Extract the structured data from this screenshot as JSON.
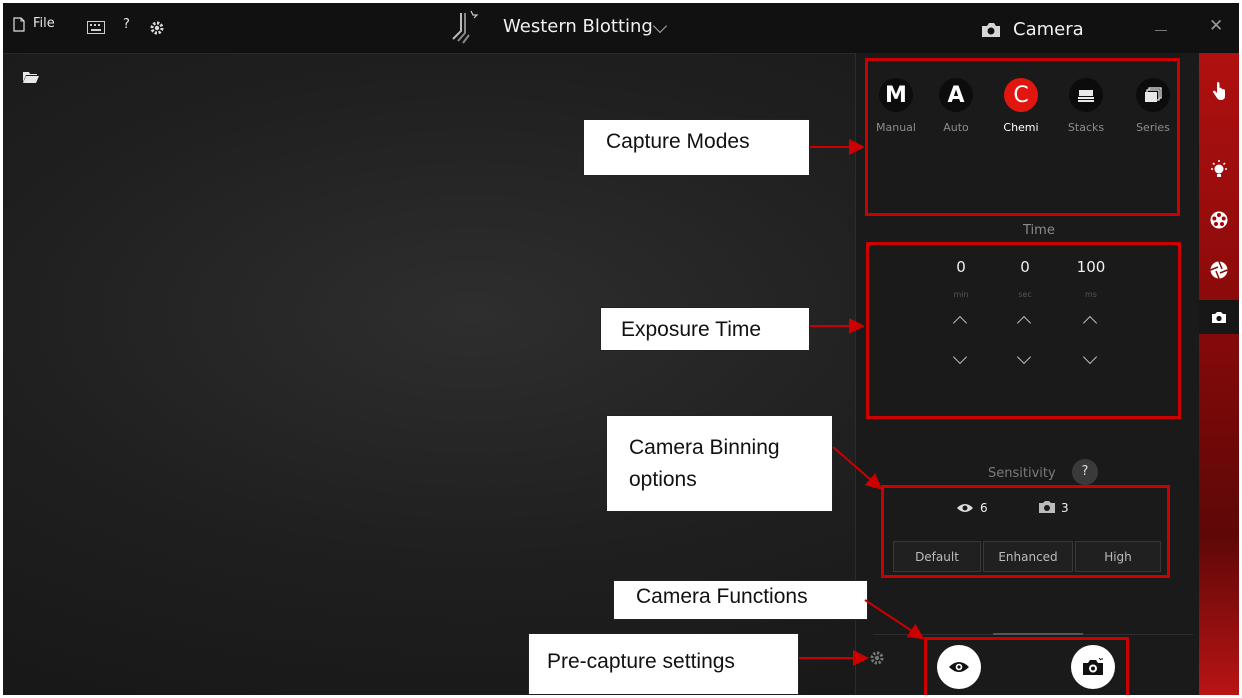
{
  "topbar": {
    "file_label": "File",
    "help_label": "?",
    "app_title": "Western Blotting",
    "camera_label": "Camera",
    "close_label": "✕",
    "icons": [
      "file-icon",
      "keyboard-icon",
      "settings-icon",
      "app-logo-icon",
      "chevron-down-icon",
      "camera-icon",
      "minimize-icon",
      "close-icon"
    ]
  },
  "capture_modes": [
    {
      "symbol": "M",
      "label": "Manual",
      "active": false
    },
    {
      "symbol": "A",
      "label": "Auto",
      "active": false
    },
    {
      "symbol": "C",
      "label": "Chemi",
      "active": true
    },
    {
      "symbol": "",
      "label": "Stacks",
      "active": false,
      "icon": "stacks-icon"
    },
    {
      "symbol": "",
      "label": "Series",
      "active": false,
      "icon": "series-icon"
    }
  ],
  "exposure": {
    "header": "Time",
    "min": {
      "value": "0",
      "unit": "min"
    },
    "sec": {
      "value": "0",
      "unit": "sec"
    },
    "ms": {
      "value": "100",
      "unit": "ms"
    }
  },
  "sensitivity": {
    "header": "Sensitivity",
    "help": "?",
    "preview_value": "6",
    "capture_value": "3",
    "options": [
      "Default",
      "Enhanced",
      "High"
    ]
  },
  "sidebar_icons": [
    "touch-icon",
    "light-icon",
    "filter-wheel-icon",
    "aperture-icon",
    "camera-icon"
  ],
  "annotations": {
    "capture_modes": "Capture Modes",
    "exposure_time": "Exposure Time",
    "camera_binning_line1": "Camera Binning",
    "camera_binning_line2": "options",
    "camera_functions": "Camera Functions",
    "pre_capture": "Pre-capture settings"
  },
  "colors": {
    "accent_red": "#e0160f",
    "annotation_red": "#cc0000",
    "background": "#1f1f1f"
  }
}
